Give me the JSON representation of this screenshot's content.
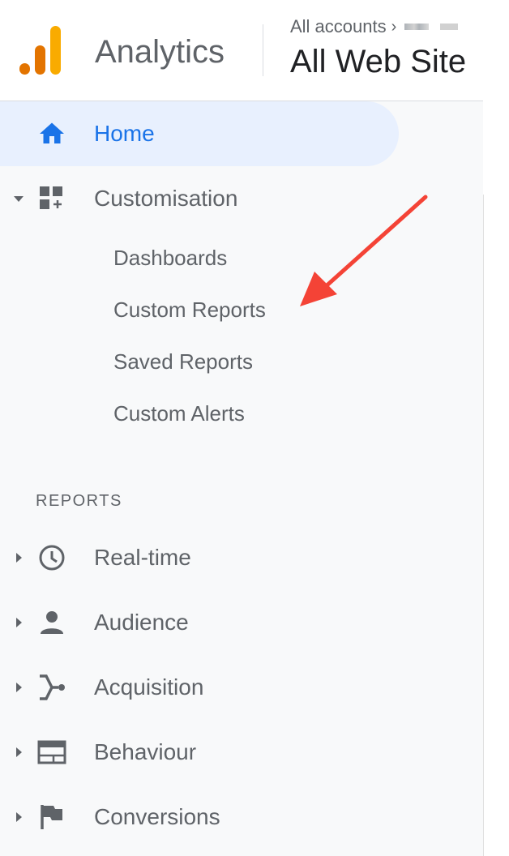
{
  "header": {
    "app_name": "Analytics",
    "breadcrumb": "All accounts",
    "view_title": "All Web Site"
  },
  "sidebar": {
    "home": {
      "label": "Home",
      "icon": "home-icon"
    },
    "customisation": {
      "label": "Customisation",
      "icon": "dashboard-customisation-icon",
      "expanded": true,
      "items": [
        "Dashboards",
        "Custom Reports",
        "Saved Reports",
        "Custom Alerts"
      ]
    },
    "reports_section": "REPORTS",
    "reports": [
      {
        "label": "Real-time",
        "icon": "clock-icon"
      },
      {
        "label": "Audience",
        "icon": "person-icon"
      },
      {
        "label": "Acquisition",
        "icon": "acquisition-icon"
      },
      {
        "label": "Behaviour",
        "icon": "behaviour-icon"
      },
      {
        "label": "Conversions",
        "icon": "flag-icon"
      }
    ]
  },
  "annotation": {
    "type": "arrow",
    "color": "#f44336",
    "points_to": "Custom Reports"
  },
  "colors": {
    "accent": "#1a73e8",
    "home_highlight": "#e8f0fe",
    "logo_orange": "#f9ab00",
    "logo_dark_orange": "#e37400",
    "text_gray": "#5f6368",
    "sidebar_bg": "#f8f9fa"
  }
}
